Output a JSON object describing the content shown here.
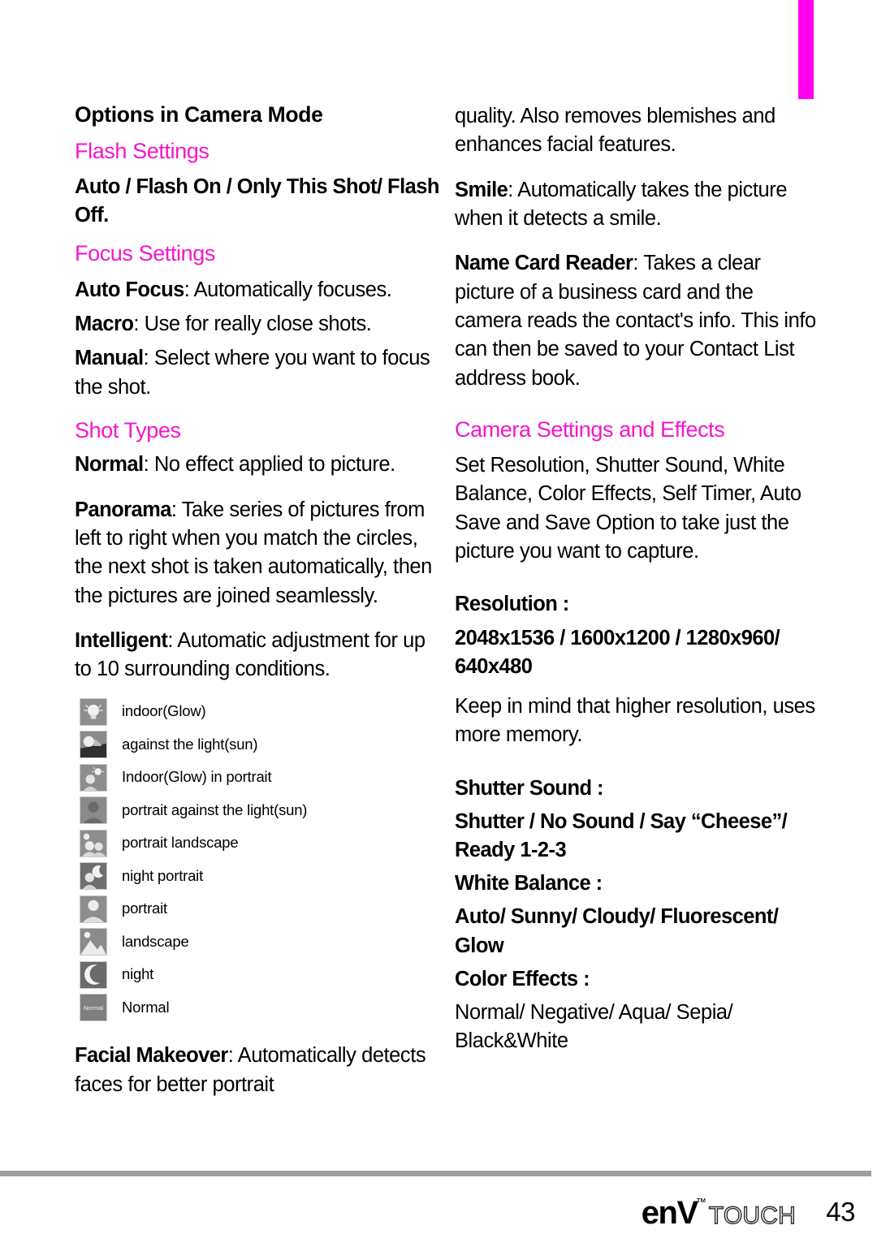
{
  "page": {
    "number": "43",
    "brand_primary": "enV",
    "brand_tm": "™",
    "brand_secondary": "TOUCH",
    "accent_color": "#F516CB",
    "tab_color": "#FF00EE"
  },
  "left_column": {
    "section_title": "Options in Camera Mode",
    "flash_heading": "Flash Settings",
    "flash_options": "Auto / Flash On / Only This Shot/ Flash Off.",
    "focus_heading": "Focus Settings",
    "focus_items": [
      {
        "term": "Auto Focus",
        "sep": ": ",
        "desc": "Automatically focuses."
      },
      {
        "term": "Macro",
        "sep": ": ",
        "desc": "Use for really close shots."
      },
      {
        "term": "Manual",
        "sep": ": ",
        "desc": "Select where you want to focus the shot."
      }
    ],
    "shot_types_heading": "Shot Types",
    "shot_types": [
      {
        "term": "Normal",
        "sep": ": ",
        "desc": "No effect applied to picture."
      },
      {
        "term": "Panorama",
        "sep": ": ",
        "desc": "Take series of pictures from left to right when you match the circles, the next shot is taken automatically, then the pictures are joined seamlessly."
      },
      {
        "term": "Intelligent",
        "sep": ": ",
        "desc": "Automatic adjustment for up to 10 surrounding conditions."
      }
    ],
    "scene_icons": [
      {
        "icon": "indoor-glow-icon",
        "label": "indoor(Glow)"
      },
      {
        "icon": "against-the-light-sun-icon",
        "label": "against the light(sun)"
      },
      {
        "icon": "indoor-glow-portrait-icon",
        "label": "Indoor(Glow) in portrait"
      },
      {
        "icon": "portrait-against-the-light-sun-icon",
        "label": "portrait against the light(sun)"
      },
      {
        "icon": "portrait-landscape-icon",
        "label": "portrait landscape"
      },
      {
        "icon": "night-portrait-icon",
        "label": "night portrait"
      },
      {
        "icon": "portrait-icon",
        "label": "portrait"
      },
      {
        "icon": "landscape-icon",
        "label": "landscape"
      },
      {
        "icon": "night-icon",
        "label": "night"
      },
      {
        "icon": "normal-scene-icon",
        "label": "Normal"
      }
    ],
    "facial_makeover": {
      "term": "Facial Makeover",
      "sep": ": ",
      "desc": "Automatically detects faces for better portrait"
    }
  },
  "right_column": {
    "facial_makeover_cont": "quality. Also removes blemishes and enhances facial features.",
    "features": [
      {
        "term": "Smile",
        "sep": ": ",
        "desc": "Automatically takes the picture when it detects a smile."
      },
      {
        "term": "Name Card Reader",
        "sep": ": ",
        "desc": "Takes a clear picture of a business card and the camera reads the contact's info. This info can then be saved to your Contact List address book."
      }
    ],
    "camera_settings_heading": "Camera Settings and Effects",
    "camera_settings_intro": "Set Resolution, Shutter Sound, White Balance, Color Effects, Self Timer, Auto Save and Save Option to take just the picture you want to capture.",
    "resolution_label": "Resolution :",
    "resolution_values": "2048x1536 / 1600x1200 / 1280x960/ 640x480",
    "resolution_note": "Keep in mind that higher resolution, uses more memory.",
    "shutter_sound_label": "Shutter Sound :",
    "shutter_sound_values": "Shutter / No Sound / Say “Cheese”/ Ready 1-2-3",
    "white_balance_label": "White Balance :",
    "white_balance_values": "Auto/ Sunny/ Cloudy/ Fluorescent/ Glow",
    "color_effects_label": "Color Effects :",
    "color_effects_values": "Normal/ Negative/ Aqua/ Sepia/ Black&White"
  }
}
